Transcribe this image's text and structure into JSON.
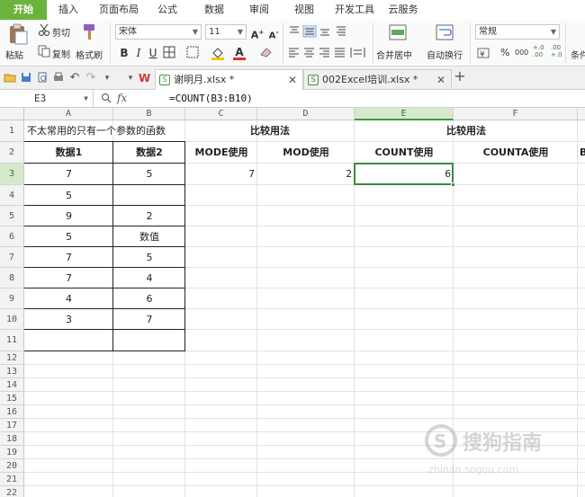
{
  "ribbon_tabs": [
    "开始",
    "插入",
    "页面布局",
    "公式",
    "数据",
    "审阅",
    "视图",
    "开发工具",
    "云服务"
  ],
  "ribbon": {
    "paste": "粘贴",
    "cut": "剪切",
    "copy": "复制",
    "format_painter": "格式刷",
    "font_name": "宋体",
    "font_size": "11",
    "merge_center": "合并居中",
    "auto_wrap": "自动换行",
    "number_format": "常规",
    "percent": "%",
    "comma": "000",
    "conditional_partial": "条件",
    "bold": "B",
    "italic": "I",
    "underline": "U",
    "grow_font": "A+",
    "shrink_font": "A-",
    "font_color_letter": "A",
    "accent_color": "#6cb33e"
  },
  "doc_tabs": [
    {
      "label": "谢明月.xlsx *",
      "active": true
    },
    {
      "label": "002Excel培训.xlsx *",
      "active": false
    }
  ],
  "formula_bar": {
    "name_box": "E3",
    "fx": "fx",
    "formula": "=COUNT(B3:B10)"
  },
  "columns": [
    "A",
    "B",
    "C",
    "D",
    "E",
    "F"
  ],
  "rows": [
    "1",
    "2",
    "3",
    "4",
    "5",
    "6",
    "7",
    "8",
    "9",
    "10",
    "11",
    "12",
    "13",
    "14",
    "15",
    "16",
    "17",
    "18",
    "19",
    "20",
    "21",
    "22"
  ],
  "cells": {
    "A1": "不太常用的只有一个参数的函数",
    "C1": "比较用法",
    "E1": "比较用法",
    "A2": "数据1",
    "B2": "数据2",
    "C2": "MODE使用",
    "D2": "MOD使用",
    "E2": "COUNT使用",
    "F2": "COUNTA使用",
    "G2": "B",
    "A3": "7",
    "B3": "5",
    "C3": "7",
    "D3": "2",
    "E3": "6",
    "A4": "5",
    "A5": "9",
    "B5": "2",
    "A6": "5",
    "B6": "数值",
    "A7": "7",
    "B7": "5",
    "A8": "7",
    "B8": "4",
    "A9": "4",
    "B9": "6",
    "A10": "3",
    "B10": "7"
  },
  "watermark": "搜狗指南"
}
